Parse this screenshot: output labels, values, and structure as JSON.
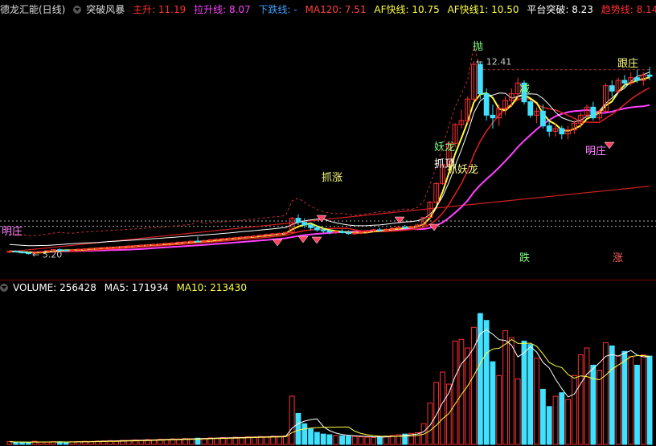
{
  "price_header": {
    "stock": "德龙汇能(日线)",
    "indicator": "突破风暴",
    "items": [
      {
        "label": "主升: 11.19",
        "color": "#ff3030"
      },
      {
        "label": "拉升线: 8.07",
        "color": "#ff40ff"
      },
      {
        "label": "下跌线: -",
        "color": "#40a0ff"
      },
      {
        "label": "MA120: 7.51",
        "color": "#ff4040"
      },
      {
        "label": "AF快线: 10.75",
        "color": "#ffff40"
      },
      {
        "label": "AF快线1: 10.50",
        "color": "#ffff40"
      },
      {
        "label": "平台突破: 8.23",
        "color": "#ffffff"
      },
      {
        "label": "趋势线: 8.14",
        "color": "#ff3030"
      }
    ]
  },
  "volume_header": {
    "items": [
      {
        "label": "VOLUME: 256428",
        "color": "#ffffff"
      },
      {
        "label": "MA5: 171934",
        "color": "#ffffff"
      },
      {
        "label": "MA10: 213430",
        "color": "#ffff40"
      }
    ]
  },
  "annotations": {
    "high_label": "12.41",
    "low_label": "5.20",
    "tags": [
      "抓涨",
      "妖龙",
      "抓顶",
      "抓妖龙",
      "抛",
      "减",
      "跟庄",
      "明庄",
      "明庄",
      "跌",
      "涨"
    ]
  },
  "chart_data": {
    "type": "candlestick",
    "price_range": [
      4.5,
      13.5
    ],
    "high": 12.41,
    "low": 5.2,
    "candles": [
      [
        5.3,
        5.35,
        5.25,
        5.32
      ],
      [
        5.32,
        5.36,
        5.28,
        5.3
      ],
      [
        5.3,
        5.34,
        5.24,
        5.26
      ],
      [
        5.26,
        5.3,
        5.2,
        5.24
      ],
      [
        5.24,
        5.3,
        5.22,
        5.28
      ],
      [
        5.28,
        5.33,
        5.25,
        5.31
      ],
      [
        5.31,
        5.36,
        5.29,
        5.34
      ],
      [
        5.34,
        5.4,
        5.32,
        5.38
      ],
      [
        5.38,
        5.42,
        5.33,
        5.36
      ],
      [
        5.36,
        5.4,
        5.32,
        5.35
      ],
      [
        5.35,
        5.39,
        5.31,
        5.37
      ],
      [
        5.37,
        5.42,
        5.35,
        5.4
      ],
      [
        5.4,
        5.44,
        5.37,
        5.41
      ],
      [
        5.41,
        5.45,
        5.38,
        5.43
      ],
      [
        5.43,
        5.47,
        5.4,
        5.44
      ],
      [
        5.44,
        5.48,
        5.41,
        5.46
      ],
      [
        5.46,
        5.5,
        5.43,
        5.47
      ],
      [
        5.47,
        5.51,
        5.44,
        5.48
      ],
      [
        5.48,
        5.52,
        5.45,
        5.5
      ],
      [
        5.5,
        5.54,
        5.47,
        5.52
      ],
      [
        5.52,
        5.56,
        5.49,
        5.53
      ],
      [
        5.53,
        5.57,
        5.5,
        5.55
      ],
      [
        5.55,
        5.59,
        5.52,
        5.56
      ],
      [
        5.56,
        5.6,
        5.53,
        5.58
      ],
      [
        5.58,
        5.62,
        5.54,
        5.59
      ],
      [
        5.59,
        5.64,
        5.56,
        5.62
      ],
      [
        5.62,
        5.66,
        5.58,
        5.63
      ],
      [
        5.63,
        5.68,
        5.6,
        5.66
      ],
      [
        5.66,
        5.7,
        5.62,
        5.67
      ],
      [
        5.67,
        5.72,
        5.64,
        5.7
      ],
      [
        5.7,
        5.86,
        5.66,
        5.68
      ],
      [
        5.68,
        5.75,
        5.64,
        5.72
      ],
      [
        5.72,
        5.78,
        5.69,
        5.75
      ],
      [
        5.75,
        5.8,
        5.71,
        5.77
      ],
      [
        5.77,
        5.82,
        5.74,
        5.79
      ],
      [
        5.79,
        5.84,
        5.76,
        5.81
      ],
      [
        5.81,
        5.86,
        5.78,
        5.83
      ],
      [
        5.83,
        5.88,
        5.8,
        5.85
      ],
      [
        5.85,
        5.9,
        5.82,
        5.87
      ],
      [
        5.87,
        5.92,
        5.84,
        5.89
      ],
      [
        5.89,
        5.95,
        5.86,
        5.92
      ],
      [
        5.92,
        5.98,
        5.89,
        5.95
      ],
      [
        5.95,
        6.0,
        5.91,
        5.97
      ],
      [
        5.97,
        6.02,
        5.93,
        5.99
      ],
      [
        5.99,
        6.05,
        5.95,
        6.02
      ],
      [
        6.02,
        6.6,
        5.98,
        6.55
      ],
      [
        6.55,
        6.7,
        6.3,
        6.4
      ],
      [
        6.4,
        6.55,
        6.2,
        6.3
      ],
      [
        6.3,
        6.4,
        6.1,
        6.2
      ],
      [
        6.2,
        6.28,
        6.05,
        6.12
      ],
      [
        6.12,
        6.2,
        6.0,
        6.08
      ],
      [
        6.08,
        6.15,
        5.95,
        6.04
      ],
      [
        6.04,
        6.12,
        5.96,
        6.06
      ],
      [
        6.06,
        6.14,
        5.98,
        6.02
      ],
      [
        6.02,
        6.1,
        5.94,
        5.98
      ],
      [
        5.98,
        6.06,
        5.92,
        6.0
      ],
      [
        6.0,
        6.08,
        5.95,
        6.04
      ],
      [
        6.04,
        6.12,
        5.98,
        6.08
      ],
      [
        6.08,
        6.16,
        6.02,
        6.12
      ],
      [
        6.12,
        6.2,
        6.05,
        6.1
      ],
      [
        6.1,
        6.18,
        6.04,
        6.14
      ],
      [
        6.14,
        6.22,
        6.08,
        6.18
      ],
      [
        6.18,
        6.26,
        6.12,
        6.22
      ],
      [
        6.22,
        6.3,
        6.15,
        6.2
      ],
      [
        6.2,
        6.28,
        6.14,
        6.24
      ],
      [
        6.24,
        6.35,
        6.18,
        6.3
      ],
      [
        6.3,
        6.6,
        6.25,
        6.58
      ],
      [
        6.58,
        7.2,
        6.55,
        7.15
      ],
      [
        7.15,
        7.9,
        7.1,
        7.85
      ],
      [
        7.85,
        8.6,
        7.8,
        8.55
      ],
      [
        8.55,
        9.4,
        8.45,
        9.35
      ],
      [
        9.35,
        10.1,
        9.2,
        10.05
      ],
      [
        10.05,
        10.6,
        9.9,
        10.2
      ],
      [
        10.2,
        11.1,
        10.1,
        11.0
      ],
      [
        11.0,
        12.41,
        10.9,
        12.3
      ],
      [
        12.3,
        12.41,
        11.0,
        11.2
      ],
      [
        11.2,
        11.4,
        10.2,
        10.4
      ],
      [
        10.4,
        10.8,
        9.9,
        10.3
      ],
      [
        10.3,
        10.8,
        10.0,
        10.65
      ],
      [
        10.65,
        11.1,
        10.4,
        10.95
      ],
      [
        10.95,
        11.4,
        10.7,
        11.2
      ],
      [
        11.2,
        11.8,
        11.0,
        11.6
      ],
      [
        11.6,
        11.7,
        10.8,
        10.9
      ],
      [
        10.9,
        11.0,
        10.3,
        10.4
      ],
      [
        10.4,
        10.7,
        10.1,
        10.55
      ],
      [
        10.55,
        10.8,
        9.9,
        10.0
      ],
      [
        10.0,
        10.2,
        9.6,
        9.8
      ],
      [
        9.8,
        10.1,
        9.6,
        9.9
      ],
      [
        9.9,
        10.0,
        9.5,
        9.7
      ],
      [
        9.7,
        10.0,
        9.5,
        9.85
      ],
      [
        9.85,
        10.2,
        9.7,
        10.1
      ],
      [
        10.1,
        10.5,
        9.9,
        10.4
      ],
      [
        10.4,
        10.8,
        10.3,
        10.7
      ],
      [
        10.7,
        10.9,
        10.2,
        10.3
      ],
      [
        10.3,
        10.6,
        10.2,
        10.55
      ],
      [
        10.55,
        11.6,
        10.5,
        11.5
      ],
      [
        11.5,
        11.7,
        11.1,
        11.3
      ],
      [
        11.3,
        11.8,
        11.2,
        11.7
      ],
      [
        11.7,
        11.9,
        11.4,
        11.6
      ],
      [
        11.6,
        12.0,
        11.5,
        11.8
      ],
      [
        11.8,
        12.1,
        11.6,
        11.7
      ],
      [
        11.7,
        12.0,
        11.5,
        11.9
      ],
      [
        11.9,
        12.2,
        11.7,
        11.85
      ]
    ],
    "volume_range": [
      0,
      420000
    ],
    "volume": [
      8000,
      6000,
      7000,
      5000,
      9000,
      7000,
      6500,
      8000,
      7200,
      6800,
      7500,
      8200,
      9000,
      8500,
      9500,
      10000,
      11000,
      10500,
      12000,
      11500,
      13000,
      12500,
      14000,
      13500,
      15000,
      14500,
      16000,
      15500,
      17000,
      16500,
      18000,
      17500,
      19000,
      18500,
      20000,
      19500,
      21000,
      20500,
      22000,
      21500,
      23000,
      22500,
      24000,
      23500,
      25000,
      140000,
      90000,
      60000,
      45000,
      35000,
      30000,
      28000,
      26000,
      25000,
      24000,
      23000,
      22000,
      21000,
      20000,
      22000,
      24000,
      26000,
      28000,
      30000,
      32000,
      34000,
      60000,
      120000,
      180000,
      210000,
      175000,
      300000,
      305000,
      280000,
      340000,
      380000,
      360000,
      240000,
      200000,
      330000,
      310000,
      190000,
      300000,
      290000,
      250000,
      160000,
      110000,
      140000,
      150000,
      130000,
      200000,
      260000,
      280000,
      230000,
      215000,
      295000,
      286000,
      256428,
      270000,
      255000,
      230000,
      260000,
      256428
    ],
    "ma5": 171934,
    "ma10": 213430
  }
}
